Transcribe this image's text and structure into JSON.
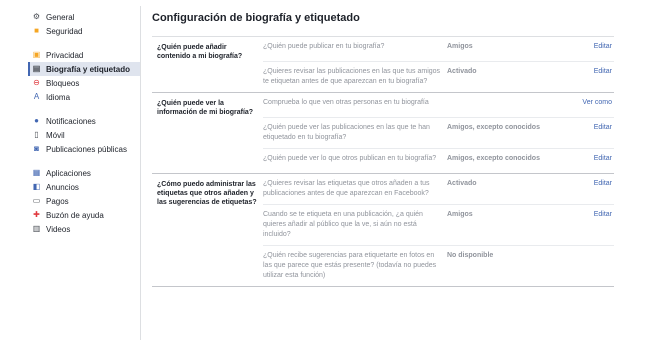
{
  "sidebar": {
    "groups": [
      [
        {
          "label": "General",
          "icon": "gear-icon",
          "color": "#4b4f56"
        },
        {
          "label": "Seguridad",
          "icon": "shield-icon",
          "color": "#f5a623"
        }
      ],
      [
        {
          "label": "Privacidad",
          "icon": "lock-icon",
          "color": "#f5a623"
        },
        {
          "label": "Biografía y etiquetado",
          "icon": "timeline-icon",
          "color": "#4b4f56",
          "active": true
        },
        {
          "label": "Bloqueos",
          "icon": "block-icon",
          "color": "#e0393e"
        },
        {
          "label": "Idioma",
          "icon": "language-icon",
          "color": "#4267b2"
        }
      ],
      [
        {
          "label": "Notificaciones",
          "icon": "globe-icon",
          "color": "#4267b2"
        },
        {
          "label": "Móvil",
          "icon": "mobile-icon",
          "color": "#4b4f56"
        },
        {
          "label": "Publicaciones públicas",
          "icon": "rss-icon",
          "color": "#4267b2"
        }
      ],
      [
        {
          "label": "Aplicaciones",
          "icon": "apps-icon",
          "color": "#4267b2"
        },
        {
          "label": "Anuncios",
          "icon": "ads-icon",
          "color": "#4267b2"
        },
        {
          "label": "Pagos",
          "icon": "card-icon",
          "color": "#4b4f56"
        },
        {
          "label": "Buzón de ayuda",
          "icon": "lifebuoy-icon",
          "color": "#e0393e"
        },
        {
          "label": "Videos",
          "icon": "film-icon",
          "color": "#4b4f56"
        }
      ]
    ]
  },
  "main": {
    "title": "Configuración de biografía y etiquetado",
    "sections": [
      {
        "label": "¿Quién puede añadir contenido a mi biografía?",
        "rows": [
          {
            "question": "¿Quién puede publicar en tu biografía?",
            "value": "Amigos",
            "action": "Editar"
          },
          {
            "question": "¿Quieres revisar las publicaciones en las que tus amigos te etiquetan antes de que aparezcan en tu biografía?",
            "value": "Activado",
            "action": "Editar"
          }
        ]
      },
      {
        "label": "¿Quién puede ver la información de mi biografía?",
        "rows": [
          {
            "question": "Comprueba lo que ven otras personas en tu biografía",
            "value": "",
            "action": "Ver como"
          },
          {
            "question": "¿Quién puede ver las publicaciones en las que te han etiquetado en tu biografía?",
            "value": "Amigos, excepto conocidos",
            "action": "Editar"
          },
          {
            "question": "¿Quién puede ver lo que otros publican en tu biografía?",
            "value": "Amigos, excepto conocidos",
            "action": "Editar"
          }
        ]
      },
      {
        "label": "¿Cómo puedo administrar las etiquetas que otros añaden y las sugerencias de etiquetas?",
        "rows": [
          {
            "question": "¿Quieres revisar las etiquetas que otros añaden a tus publicaciones antes de que aparezcan en Facebook?",
            "value": "Activado",
            "action": "Editar"
          },
          {
            "question": "Cuando se te etiqueta en una publicación, ¿a quién quieres añadir al público que la ve, si aún no está incluido?",
            "value": "Amigos",
            "action": "Editar"
          },
          {
            "question": "¿Quién recibe sugerencias para etiquetarte en fotos en las que parece que estás presente? (todavía no puedes utilizar esta función)",
            "value": "No disponible",
            "action": ""
          }
        ]
      }
    ]
  }
}
